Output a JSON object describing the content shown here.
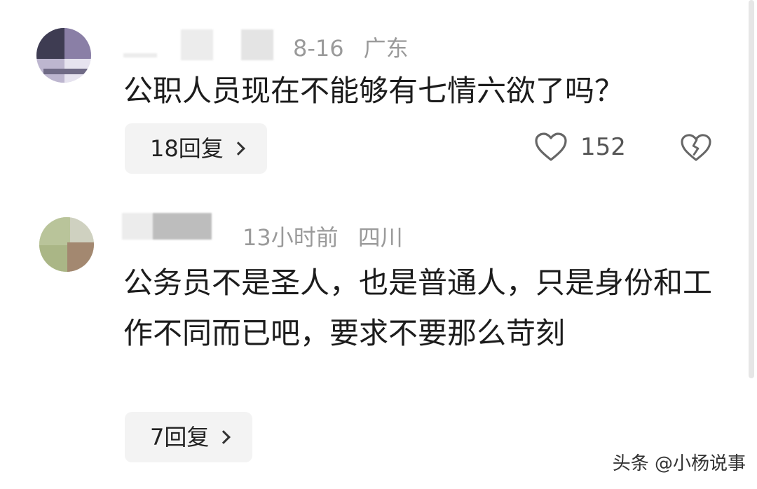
{
  "comments": [
    {
      "date": "8-16",
      "location": "广东",
      "text": "公职人员现在不能够有七情六欲了吗？",
      "reply_label": "18回复",
      "likes": "152"
    },
    {
      "date": "13小时前",
      "location": "四川",
      "text": "公务员不是圣人，也是普通人，只是身份和工作不同而已吧，要求不要那么苛刻",
      "reply_label": "7回复"
    }
  ],
  "icons": {
    "like": "heart-icon",
    "dislike": "broken-heart-icon",
    "reply_chevron": "chevron-right-icon"
  },
  "watermark": "头条 @小杨说事",
  "colors": {
    "meta_gray": "#9a9a9a",
    "reply_bg": "#f3f3f3",
    "text": "#1c1c1c"
  }
}
